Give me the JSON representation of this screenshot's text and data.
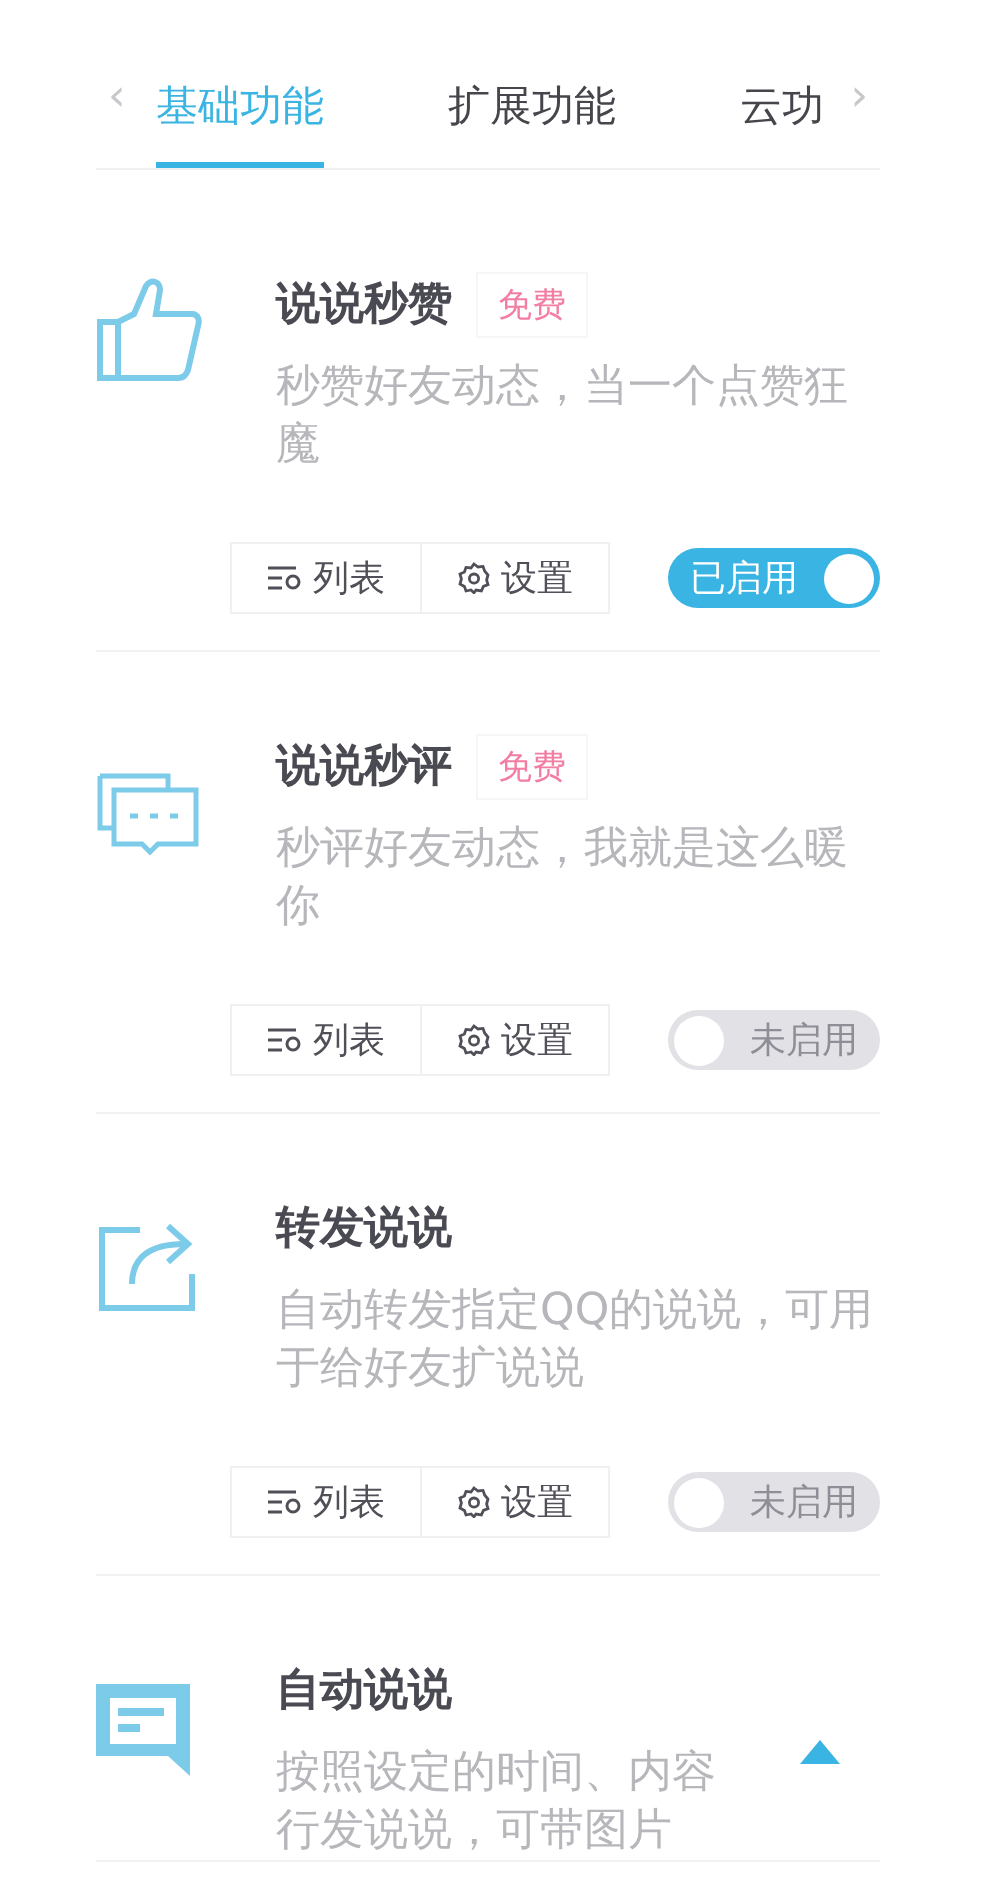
{
  "tabs": {
    "prev": "‹",
    "next": "›",
    "items": [
      {
        "label": "基础功能",
        "selected": true
      },
      {
        "label": "扩展功能",
        "selected": false
      },
      {
        "label": "云功",
        "selected": false
      }
    ]
  },
  "features": [
    {
      "title": "说说秒赞",
      "tag": "免费",
      "description": [
        "秒赞好友动态，当一个点赞狂魔"
      ],
      "actions": [
        "列表",
        "设置"
      ],
      "switch": {
        "on": true,
        "label": "已启用"
      }
    },
    {
      "title": "说说秒评",
      "tag": "免费",
      "description": [
        "秒评好友动态，我就是这么暖你"
      ],
      "actions": [
        "列表",
        "设置"
      ],
      "switch": {
        "on": false,
        "label": "未启用"
      }
    },
    {
      "title": "转发说说",
      "description": [
        "自动转发指定QQ的说说，可用于给好友扩说说"
      ],
      "actions": [
        "列表",
        "设置"
      ],
      "switch": {
        "on": false,
        "label": "未启用"
      }
    },
    {
      "title": "自动说说",
      "description": [
        "按照设定的时间、内容",
        "行发说说，可带图片"
      ]
    }
  ],
  "scroll_top": true
}
